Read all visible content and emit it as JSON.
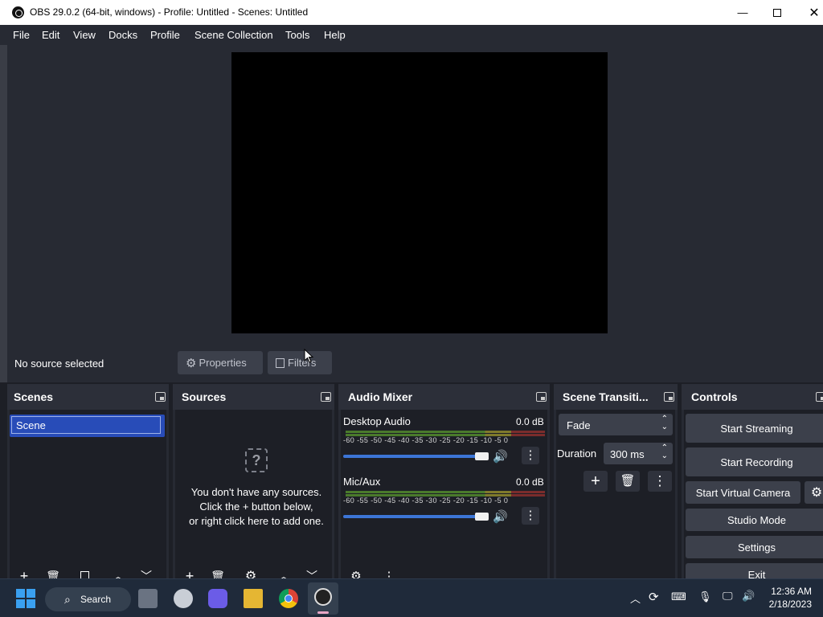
{
  "window": {
    "title": "OBS 29.0.2 (64-bit, windows) - Profile: Untitled - Scenes: Untitled",
    "min_icon": "minimize-icon",
    "max_icon": "maximize-icon",
    "close_icon": "close-icon"
  },
  "menu": [
    "File",
    "Edit",
    "View",
    "Docks",
    "Profile",
    "Scene Collection",
    "Tools",
    "Help"
  ],
  "context": {
    "no_source": "No source selected",
    "properties": "Properties",
    "filters": "Filters"
  },
  "scenes": {
    "title": "Scenes",
    "items": [
      "Scene"
    ]
  },
  "sources": {
    "title": "Sources",
    "empty_line1": "You don't have any sources.",
    "empty_line2": "Click the + button below,",
    "empty_line3": "or right click here to add one."
  },
  "mixer": {
    "title": "Audio Mixer",
    "ticks": "-60 -55 -50 -45 -40 -35 -30 -25 -20 -15 -10  -5   0",
    "channels": [
      {
        "name": "Desktop Audio",
        "db": "0.0 dB",
        "volume": 1.0
      },
      {
        "name": "Mic/Aux",
        "db": "0.0 dB",
        "volume": 1.0
      }
    ]
  },
  "transitions": {
    "title": "Scene Transiti...",
    "type": "Fade",
    "duration_label": "Duration",
    "duration_value": "300 ms"
  },
  "controls": {
    "title": "Controls",
    "start_streaming": "Start Streaming",
    "start_recording": "Start Recording",
    "start_virtual_camera": "Start Virtual Camera",
    "studio_mode": "Studio Mode",
    "settings": "Settings",
    "exit": "Exit"
  },
  "taskbar": {
    "search": "Search",
    "time": "12:36 AM",
    "date": "2/18/2023"
  },
  "colors": {
    "accent": "#284cb8",
    "panel": "#272a33",
    "dock_bg": "#1d1f26",
    "button": "#3c404b",
    "slider": "#3c75d6"
  }
}
